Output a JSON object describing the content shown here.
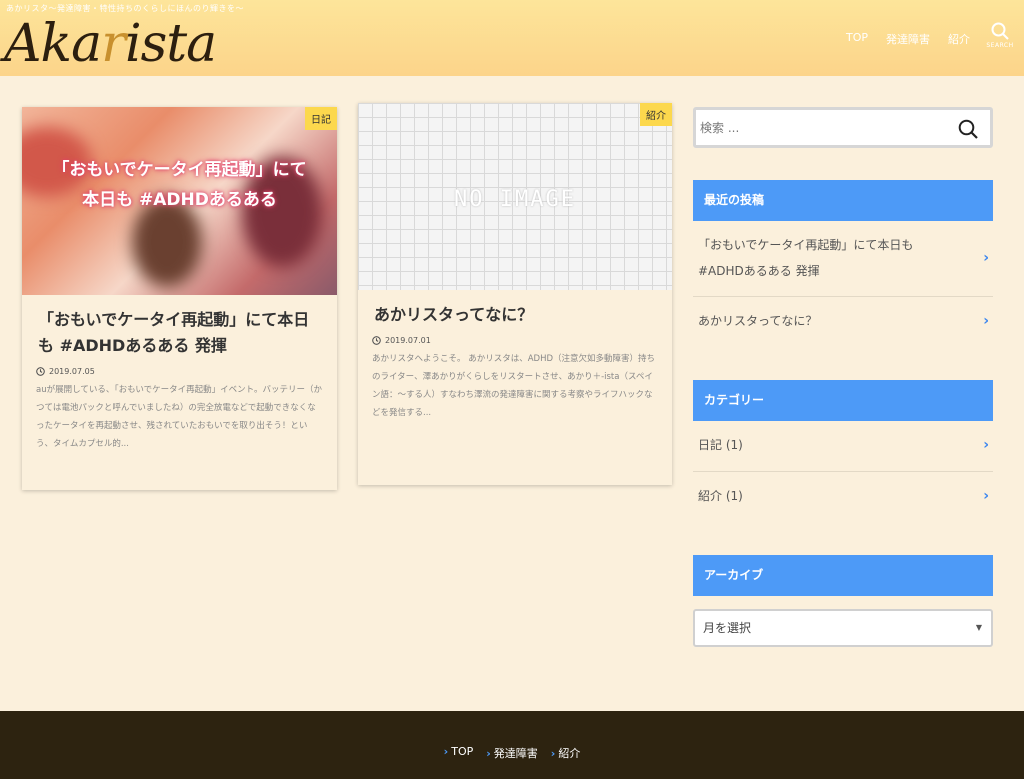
{
  "header": {
    "tagline": "あかリスタ〜発達障害・特性持ちのくらしにほんのり輝きを〜",
    "logo": {
      "pre": "Aka",
      "accent": "r",
      "post": "ista"
    },
    "nav": [
      "TOP",
      "発達障害",
      "紹介"
    ],
    "search_label": "SEARCH"
  },
  "posts": [
    {
      "category": "日記",
      "thumb_text_line1": "「おもいでケータイ再起動」にて",
      "thumb_text_line2": "本日も #ADHDあるある",
      "title": "「おもいでケータイ再起動」にて本日も #ADHDあるある 発揮",
      "date": "2019.07.05",
      "excerpt": "auが展開している、「おもいでケータイ再起動」イベント。バッテリー（かつては電池パックと呼んでいましたね）の完全放電などで起動できなくなったケータイを再起動させ、残されていたおもいでを取り出そう！という、タイムカプセル的..."
    },
    {
      "category": "紹介",
      "thumb_text": "NO IMAGE",
      "title": "あかリスタってなに？",
      "date": "2019.07.01",
      "excerpt": "あかリスタへようこそ。 あかリスタは、ADHD（注意欠如多動障害）持ちのライター、澤あかりがくらしをリスタートさせ、あかり＋-ista（スペイン語：〜する人）すなわち澤流の発達障害に関する考察やライフハックなどを発信する..."
    }
  ],
  "sidebar": {
    "search_placeholder": "検索 ...",
    "recent_heading": "最近の投稿",
    "recent": [
      "「おもいでケータイ再起動」にて本日も #ADHDあるある 発揮",
      "あかリスタってなに？"
    ],
    "category_heading": "カテゴリー",
    "categories": [
      "日記 (1)",
      "紹介 (1)"
    ],
    "archive_heading": "アーカイブ",
    "archive_select": "月を選択"
  },
  "footer": {
    "nav": [
      "TOP",
      "発達障害",
      "紹介"
    ]
  },
  "colors": {
    "accent": "#4d9af7",
    "header": "#fcd88e",
    "background": "#fbf0dc",
    "footer": "#2d2310",
    "badge": "#fcd84d"
  }
}
